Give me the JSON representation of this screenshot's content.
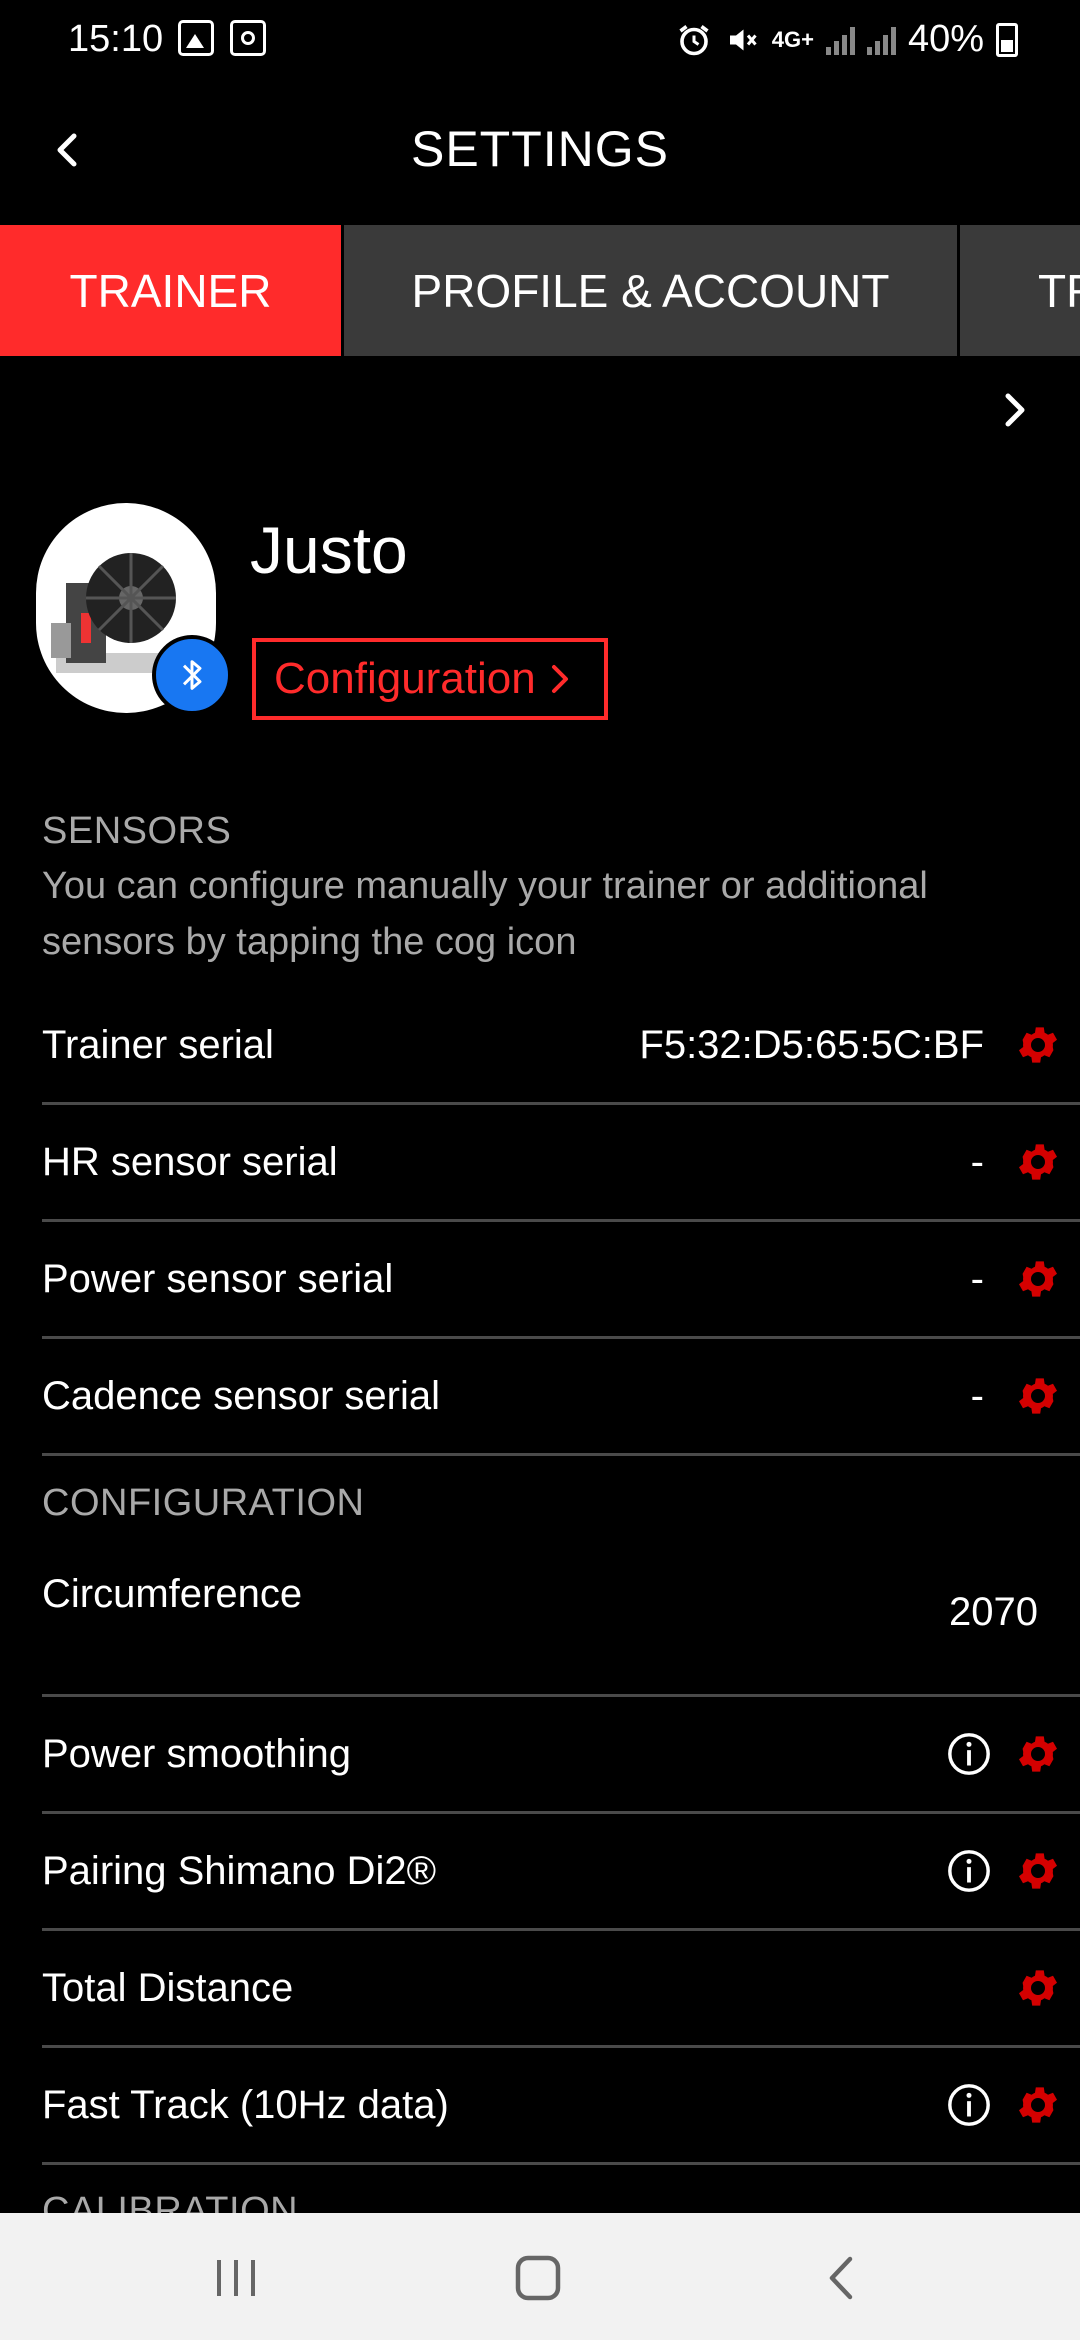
{
  "status_bar": {
    "time": "15:10",
    "network": "4G+",
    "battery": "40%"
  },
  "header": {
    "title": "SETTINGS"
  },
  "tabs": [
    {
      "label": "TRAINER",
      "active": true
    },
    {
      "label": "PROFILE & ACCOUNT",
      "active": false
    },
    {
      "label": "TR",
      "active": false
    }
  ],
  "device": {
    "name": "Justo",
    "config_label": "Configuration"
  },
  "sensors": {
    "title": "SENSORS",
    "description": "You can configure manually your trainer or additional sensors by tapping the cog icon",
    "rows": [
      {
        "label": "Trainer serial",
        "value": "F5:32:D5:65:5C:BF"
      },
      {
        "label": "HR sensor serial",
        "value": "-"
      },
      {
        "label": "Power sensor serial",
        "value": "-"
      },
      {
        "label": "Cadence sensor serial",
        "value": "-"
      }
    ]
  },
  "configuration": {
    "title": "CONFIGURATION",
    "circumference": {
      "label": "Circumference",
      "value": "2070"
    },
    "rows": [
      {
        "label": "Power smoothing"
      },
      {
        "label": "Pairing Shimano Di2®"
      },
      {
        "label": "Total Distance"
      },
      {
        "label": "Fast Track (10Hz data)"
      }
    ]
  },
  "next_section_partial": "CALIBRATION",
  "colors": {
    "accent": "#ff2b2b",
    "gear": "#d40000",
    "bluetooth": "#1877f2",
    "tab_inactive": "#3a3a3a",
    "muted_text": "#a9a9a9"
  }
}
